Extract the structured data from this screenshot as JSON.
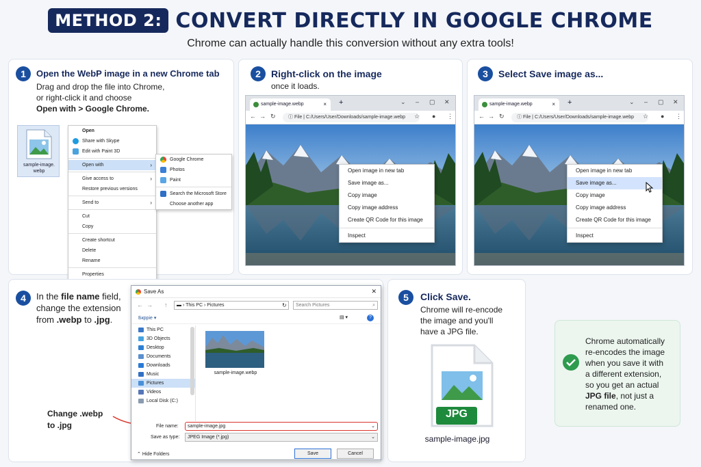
{
  "header": {
    "badge": "METHOD 2:",
    "title": "CONVERT DIRECTLY IN GOOGLE CHROME",
    "subtitle": "Chrome can actually handle this conversion without any extra tools!"
  },
  "step1": {
    "num": "1",
    "title": "Open the WebP image in a new Chrome tab",
    "line1": "Drag and drop the file into Chrome,",
    "line2": "or right-click it and choose",
    "line3": "Open with > Google Chrome.",
    "file_label_1": "sample-image.",
    "file_label_2": "webp",
    "context_menu": [
      "Open",
      "Share with Skype",
      "Edit with Paint 3D",
      "Open with",
      "Give access to",
      "Restore previous versions",
      "Send to",
      "Cut",
      "Copy",
      "Create shortcut",
      "Delete",
      "Rename",
      "Properties"
    ],
    "submenu": [
      "Google Chrome",
      "Photos",
      "Paint",
      "Search the Microsoft Store",
      "Choose another app"
    ]
  },
  "step2": {
    "num": "2",
    "title": "Right-click on the image",
    "body": "once it loads.",
    "tab_title": "sample-image.webp",
    "url_prefix": "File",
    "url": "C:/Users/User/Downloads/sample-image.webp",
    "menu": [
      "Open image in new tab",
      "Save image as...",
      "Copy image",
      "Copy image address",
      "Create QR Code for this image",
      "Inspect"
    ]
  },
  "step3": {
    "num": "3",
    "title": "Select Save image as...",
    "tab_title": "sample-image.webp",
    "url_prefix": "File",
    "url": "C:/Users/User/Downloads/sample-image.webp",
    "menu": [
      "Open image in new tab",
      "Save image as...",
      "Copy image",
      "Copy image address",
      "Create QR Code for this image",
      "Inspect"
    ],
    "selected_index": 1
  },
  "step4": {
    "num": "4",
    "line1a": "In the ",
    "line1b": "file name",
    "line1c": " field,",
    "line2": "change the extension",
    "line3a": "from ",
    "line3b": ".webp",
    "line3c": " to ",
    "line3d": ".jpg",
    "line3e": ".",
    "callout_1": "Change .webp",
    "callout_2": "to .jpg",
    "dialog": {
      "title": "Save As",
      "path_1": "This PC",
      "path_2": "Pictures",
      "search_placeholder": "Search Pictures",
      "organize": "Бкрріе",
      "tree": [
        "This PC",
        "3D Objects",
        "Desktop",
        "Documents",
        "Downloads",
        "Music",
        "Pictures",
        "Videos",
        "Local Disk (C:)"
      ],
      "thumb_label": "sample-image.webp",
      "file_name_label": "File name:",
      "file_name_value": "sample-image.jpg",
      "save_type_label": "Save as type:",
      "save_type_value": "JPEG Image (*.jpg)",
      "hide_folders": "Hide Folders",
      "save": "Save",
      "cancel": "Cancel"
    }
  },
  "step5": {
    "num": "5",
    "title": "Click Save.",
    "line1": "Chrome will re-encode",
    "line2": "the image and you'll",
    "line3": "have a JPG file.",
    "file_badge": "JPG",
    "file_label": "sample-image.jpg"
  },
  "tip": {
    "line1": "Chrome automatically",
    "line2": "re-encodes the image",
    "line3": "when you save it with",
    "line4": "a different extension,",
    "line5": "so you get an actual",
    "line6a": "JPG file",
    "line6b": ", not just a",
    "line7": "renamed one."
  },
  "colors": {
    "navy": "#16295c",
    "step_blue": "#1a4fa0",
    "callout_red": "#d9332b",
    "tip_green": "#2e9b4e",
    "jpg_green": "#1e8a3c"
  }
}
